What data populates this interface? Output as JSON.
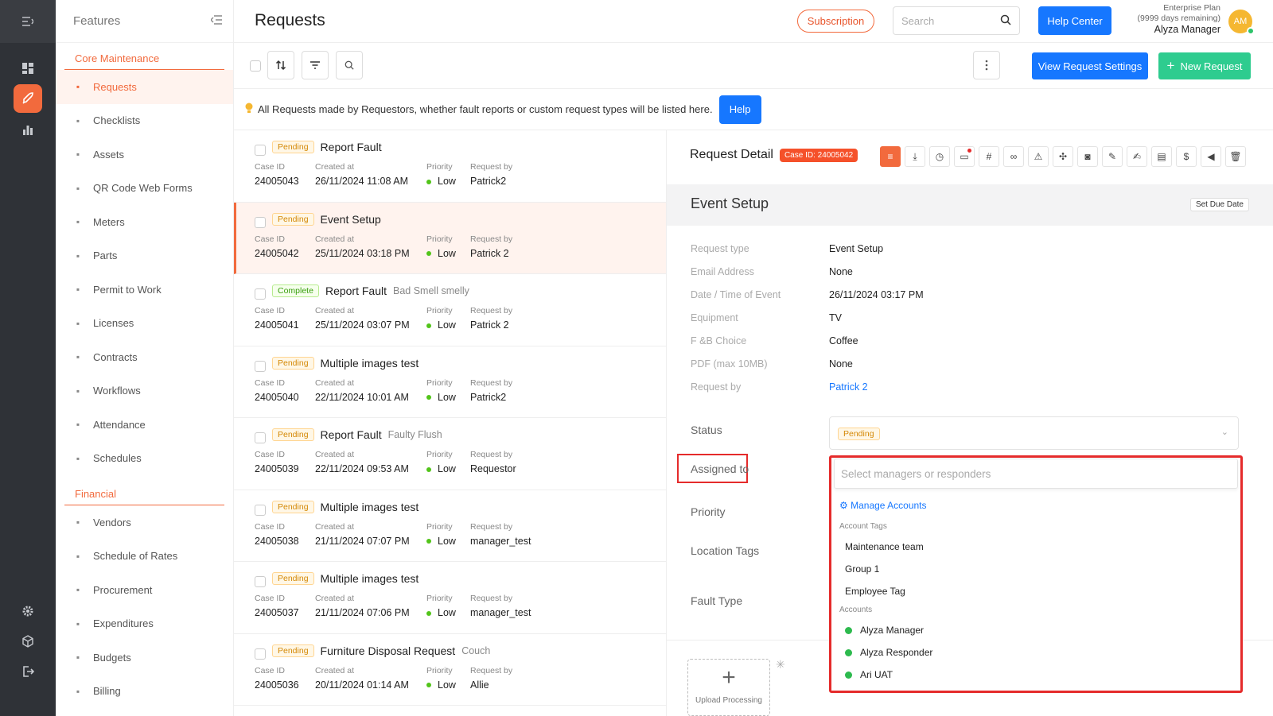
{
  "sidebar": {
    "heading": "Features",
    "section_core": "Core Maintenance",
    "section_financial": "Financial",
    "core_items": [
      {
        "label": "Requests",
        "icon": "request-icon"
      },
      {
        "label": "Checklists",
        "icon": "checklist-icon"
      },
      {
        "label": "Assets",
        "icon": "asset-icon"
      },
      {
        "label": "QR Code Web Forms",
        "icon": "qr-icon"
      },
      {
        "label": "Meters",
        "icon": "meter-icon"
      },
      {
        "label": "Parts",
        "icon": "parts-icon"
      },
      {
        "label": "Permit to Work",
        "icon": "permit-icon"
      },
      {
        "label": "Licenses",
        "icon": "license-icon"
      },
      {
        "label": "Contracts",
        "icon": "contract-icon"
      },
      {
        "label": "Workflows",
        "icon": "workflow-icon"
      },
      {
        "label": "Attendance",
        "icon": "attendance-icon"
      },
      {
        "label": "Schedules",
        "icon": "calendar-icon"
      }
    ],
    "financial_items": [
      {
        "label": "Vendors",
        "icon": "vendor-icon"
      },
      {
        "label": "Schedule of Rates",
        "icon": "dollar-icon"
      },
      {
        "label": "Procurement",
        "icon": "procurement-icon"
      },
      {
        "label": "Expenditures",
        "icon": "expenditure-icon"
      },
      {
        "label": "Budgets",
        "icon": "budget-icon"
      },
      {
        "label": "Billing",
        "icon": "billing-icon"
      }
    ]
  },
  "header": {
    "title": "Requests",
    "subscription": "Subscription",
    "search_placeholder": "Search",
    "help_center": "Help Center",
    "plan_line1": "Enterprise Plan",
    "plan_line2": "(9999 days remaining)",
    "user_name": "Alyza Manager",
    "avatar_initials": "AM"
  },
  "toolbar": {
    "view_settings": "View Request Settings",
    "new_request": "New Request"
  },
  "notice": {
    "text": "All Requests made by Requestors, whether fault reports or custom request types will be listed here.",
    "help": "Help"
  },
  "list_labels": {
    "case": "Case ID",
    "created": "Created at",
    "priority": "Priority",
    "by": "Request by"
  },
  "requests": [
    {
      "status": "Pending",
      "title": "Report Fault",
      "subtitle": "",
      "case_id": "24005043",
      "created": "26/11/2024 11:08 AM",
      "priority": "Low",
      "by": "Patrick2"
    },
    {
      "status": "Pending",
      "title": "Event Setup",
      "subtitle": "",
      "case_id": "24005042",
      "created": "25/11/2024 03:18 PM",
      "priority": "Low",
      "by": "Patrick 2"
    },
    {
      "status": "Complete",
      "title": "Report Fault",
      "subtitle": "Bad Smell smelly",
      "case_id": "24005041",
      "created": "25/11/2024 03:07 PM",
      "priority": "Low",
      "by": "Patrick 2"
    },
    {
      "status": "Pending",
      "title": "Multiple images test",
      "subtitle": "",
      "case_id": "24005040",
      "created": "22/11/2024 10:01 AM",
      "priority": "Low",
      "by": "Patrick2"
    },
    {
      "status": "Pending",
      "title": "Report Fault",
      "subtitle": "Faulty Flush",
      "case_id": "24005039",
      "created": "22/11/2024 09:53 AM",
      "priority": "Low",
      "by": "Requestor"
    },
    {
      "status": "Pending",
      "title": "Multiple images test",
      "subtitle": "",
      "case_id": "24005038",
      "created": "21/11/2024 07:07 PM",
      "priority": "Low",
      "by": "manager_test"
    },
    {
      "status": "Pending",
      "title": "Multiple images test",
      "subtitle": "",
      "case_id": "24005037",
      "created": "21/11/2024 07:06 PM",
      "priority": "Low",
      "by": "manager_test"
    },
    {
      "status": "Pending",
      "title": "Furniture Disposal Request",
      "subtitle": "Couch",
      "case_id": "24005036",
      "created": "20/11/2024 01:14 AM",
      "priority": "Low",
      "by": "Allie"
    }
  ],
  "detail": {
    "heading": "Request Detail",
    "case_badge": "Case ID: 24005042",
    "title": "Event Setup",
    "set_due": "Set Due Date",
    "fields": [
      {
        "k": "Request type",
        "v": "Event Setup"
      },
      {
        "k": "Email Address",
        "v": "None"
      },
      {
        "k": "Date / Time of Event",
        "v": "26/11/2024 03:17 PM"
      },
      {
        "k": "Equipment",
        "v": "TV"
      },
      {
        "k": "F &B Choice",
        "v": "Coffee"
      },
      {
        "k": "PDF (max 10MB)",
        "v": "None"
      },
      {
        "k": "Request by",
        "v": "Patrick 2"
      }
    ],
    "status_label": "Status",
    "status_value": "Pending",
    "assigned_label": "Assigned to",
    "priority_label": "Priority",
    "location_label": "Location Tags",
    "fault_label": "Fault Type",
    "upload_label": "Upload Processing"
  },
  "dropdown": {
    "placeholder": "Select managers or responders",
    "manage": "Manage Accounts",
    "tags_heading": "Account Tags",
    "tags": [
      "Maintenance team",
      "Group 1",
      "Employee Tag"
    ],
    "accounts_heading": "Accounts",
    "accounts": [
      "Alyza Manager",
      "Alyza Responder",
      "Ari UAT"
    ]
  },
  "colors": {
    "accent": "#f26a3d",
    "primary": "#1677ff",
    "success": "#2ecc8f"
  }
}
